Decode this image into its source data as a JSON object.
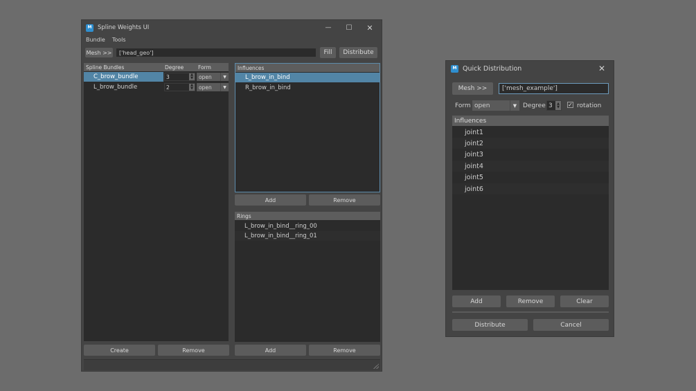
{
  "spline_window": {
    "title": "Spline Weights UI",
    "icon_text": "M",
    "controls": {
      "minimize": "—",
      "maximize": "☐",
      "close": "✕"
    },
    "menu": [
      "Bundle",
      "Tools"
    ],
    "mesh_button": "Mesh >>",
    "mesh_value": "['head_geo']",
    "fill_button": "Fill",
    "distribute_button": "Distribute",
    "bundles": {
      "headers": [
        "Spline Bundles",
        "Degree",
        "Form"
      ],
      "rows": [
        {
          "name": "C_brow_bundle",
          "degree": "3",
          "form": "open",
          "selected": true
        },
        {
          "name": "L_brow_bundle",
          "degree": "2",
          "form": "open",
          "selected": false
        }
      ],
      "create_button": "Create",
      "remove_button": "Remove"
    },
    "influences": {
      "header": "Influences",
      "items": [
        "L_brow_in_bind",
        "R_brow_in_bind"
      ],
      "add_button": "Add",
      "remove_button": "Remove"
    },
    "rings": {
      "header": "Rings",
      "items": [
        "L_brow_in_bind__ring_00",
        "L_brow_in_bind__ring_01"
      ],
      "add_button": "Add",
      "remove_button": "Remove"
    }
  },
  "quick_window": {
    "title": "Quick Distribution",
    "icon_text": "M",
    "close": "✕",
    "mesh_button": "Mesh >>",
    "mesh_value": "['mesh_example']",
    "form_label": "Form",
    "form_value": "open",
    "degree_label": "Degree",
    "degree_value": "3",
    "rotation_label": "rotation",
    "rotation_check": "✓",
    "influences_header": "Influences",
    "joints": [
      "joint1",
      "joint2",
      "joint3",
      "joint4",
      "joint5",
      "joint6"
    ],
    "add_button": "Add",
    "remove_button": "Remove",
    "clear_button": "Clear",
    "distribute_button": "Distribute",
    "cancel_button": "Cancel"
  }
}
